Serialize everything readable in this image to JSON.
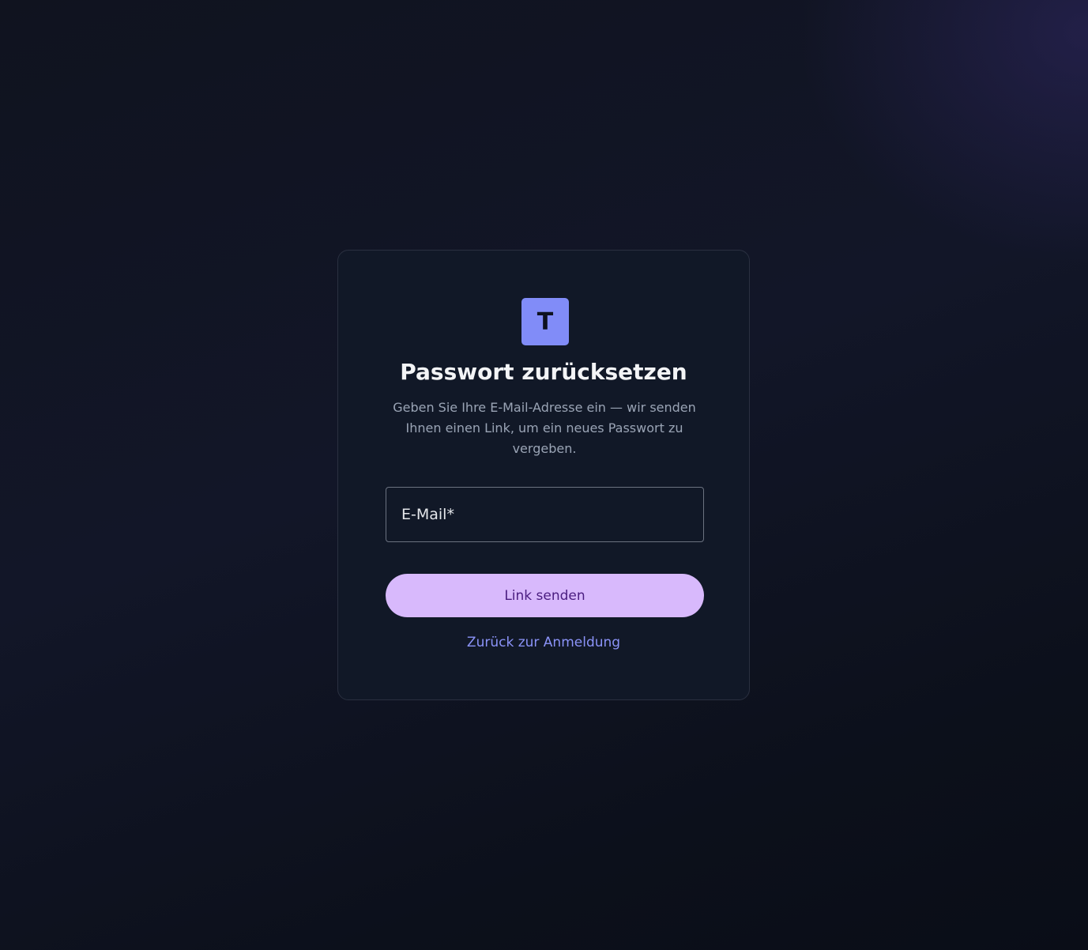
{
  "logo": {
    "letter": "T",
    "color": "#818cf8"
  },
  "title": "Passwort zurücksetzen",
  "subtitle": "Geben Sie Ihre E-Mail-Adresse ein — wir senden Ihnen einen Link, um ein neues Passwort zu vergeben.",
  "email_field": {
    "label": "E-Mail",
    "required_marker": "*",
    "value": ""
  },
  "submit_button": {
    "label": "Link senden",
    "color": "#d8b9fc"
  },
  "back_link": {
    "label": "Zurück zur Anmeldung",
    "color": "#8b93f8"
  }
}
